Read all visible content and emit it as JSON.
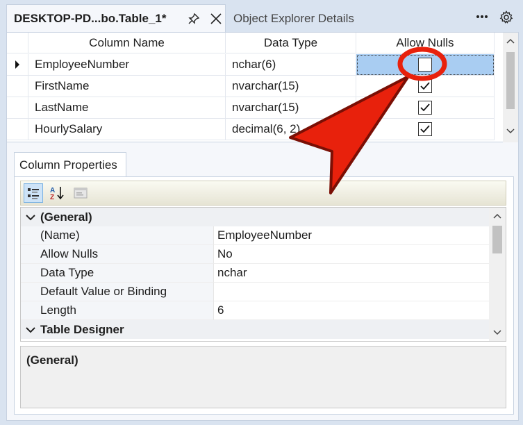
{
  "tabs": {
    "active_title": "DESKTOP-PD...bo.Table_1*",
    "inactive_title": "Object Explorer Details"
  },
  "grid": {
    "headers": [
      "Column Name",
      "Data Type",
      "Allow Nulls"
    ],
    "rows": [
      {
        "name": "EmployeeNumber",
        "type": "nchar(6)",
        "allow_nulls": false,
        "selected": true
      },
      {
        "name": "FirstName",
        "type": "nvarchar(15)",
        "allow_nulls": true,
        "selected": false
      },
      {
        "name": "LastName",
        "type": "nvarchar(15)",
        "allow_nulls": true,
        "selected": false
      },
      {
        "name": "HourlySalary",
        "type": "decimal(6, 2)",
        "allow_nulls": true,
        "selected": false
      }
    ]
  },
  "column_properties": {
    "tab_label": "Column Properties",
    "categories": {
      "general": "(General)",
      "table_designer": "Table Designer"
    },
    "properties": [
      {
        "key": "(Name)",
        "value": "EmployeeNumber"
      },
      {
        "key": "Allow Nulls",
        "value": "No"
      },
      {
        "key": "Data Type",
        "value": "nchar"
      },
      {
        "key": "Default Value or Binding",
        "value": ""
      },
      {
        "key": "Length",
        "value": "6"
      }
    ],
    "description_title": "(General)"
  },
  "annotation": {
    "color": "#e8210c",
    "target": "allow-nulls-checkbox-row-1"
  }
}
